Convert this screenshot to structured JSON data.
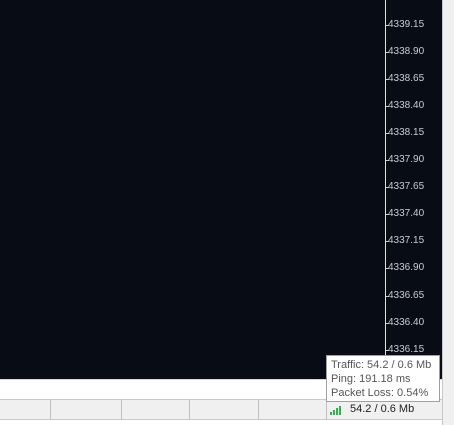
{
  "price_axis": {
    "labels": [
      "4339.15",
      "4338.90",
      "4338.65",
      "4338.40",
      "4338.15",
      "4337.90",
      "4337.65",
      "4337.40",
      "4337.15",
      "4336.90",
      "4336.65",
      "4336.40",
      "4336.15"
    ]
  },
  "connection_tooltip": {
    "traffic": "Traffic: 54.2 / 0.6 Mb",
    "ping": "Ping: 191.18 ms",
    "packet_loss": "Packet Loss: 0.54%"
  },
  "status_bar": {
    "traffic_value": "54.2 / 0.6 Mb",
    "signal_icon": "signal-bars-icon",
    "signal_color": "#2db34a"
  },
  "colors": {
    "chart_background": "#080c14",
    "axis_text": "#c8ccd4"
  }
}
